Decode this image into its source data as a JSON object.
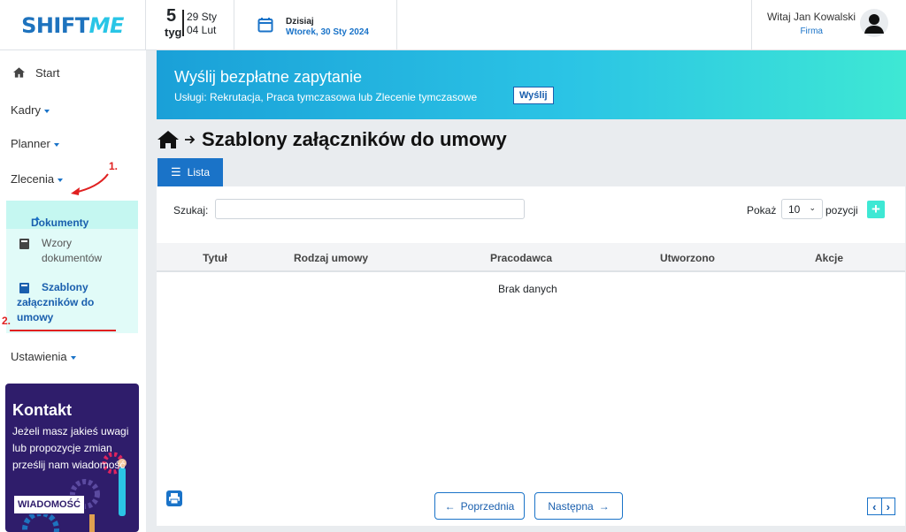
{
  "header": {
    "logo_part1": "SHIFT",
    "logo_part2": "ME",
    "week_number": "5",
    "week_label": "tyg",
    "week_start": "29 Sty",
    "week_end": "04 Lut",
    "today_label": "Dzisiaj",
    "today_date": "Wtorek, 30 Sty 2024",
    "user_greeting": "Witaj Jan Kowalski",
    "user_company": "Firma"
  },
  "sidebar": {
    "start": "Start",
    "kadry": "Kadry",
    "planner": "Planner",
    "zlecenia": "Zlecenia",
    "dokumenty": "Dokumenty",
    "wzory": "Wzory dokumentów",
    "szablony_1": "Szablony",
    "szablony_2": "załączników do",
    "szablony_3": "umowy",
    "ustawienia": "Ustawienia",
    "annotation_1": "1.",
    "annotation_2": "2."
  },
  "contact": {
    "title": "Kontakt",
    "text": "Jeżeli masz jakieś uwagi lub propozycje zmian prześlij nam wiadomość",
    "button": "WIADOMOŚĆ"
  },
  "banner": {
    "title": "Wyślij bezpłatne zapytanie",
    "subtitle": "Usługi: Rekrutacja, Praca tymczasowa lub Zlecenie tymczasowe",
    "button": "Wyślij"
  },
  "page": {
    "title": "Szablony załączników do umowy",
    "tab": "Lista",
    "search_label": "Szukaj:",
    "search_value": "",
    "show_label": "Pokaż",
    "page_size": "10",
    "items_label": "pozycji",
    "columns": [
      "Tytuł",
      "Rodzaj umowy",
      "Pracodawca",
      "Utworzono",
      "Akcje"
    ],
    "empty": "Brak danych",
    "prev": "Poprzednia",
    "next": "Następna"
  },
  "colors": {
    "primary": "#1a73c8",
    "accent": "#3ee8d4",
    "contact_bg": "#2f1d6b",
    "annotation": "#e02020"
  }
}
